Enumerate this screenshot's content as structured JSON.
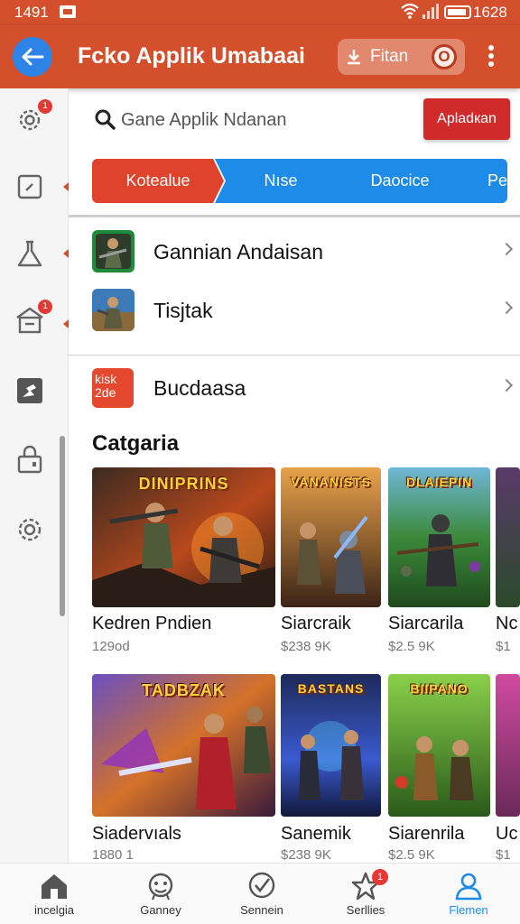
{
  "status_bar": {
    "time": "1491",
    "battery_text": "1628"
  },
  "app_bar": {
    "title": "Fcko Applik Umabaai",
    "filter_label": "Fitan",
    "record_glyph": "O"
  },
  "search": {
    "placeholder": "Gane Applik Ndanan",
    "upload_label": "Apladкan"
  },
  "tabs": [
    {
      "label": "Kotealue"
    },
    {
      "label": "Nıse"
    },
    {
      "label": "Daocice"
    },
    {
      "label": "Pe"
    }
  ],
  "side_rail": {
    "items": [
      {
        "icon": "gear-icon",
        "badge": "1"
      },
      {
        "icon": "note-icon",
        "badge": ""
      },
      {
        "icon": "flask-icon",
        "badge": ""
      },
      {
        "icon": "store-icon",
        "badge": "1"
      },
      {
        "icon": "puzzle-icon",
        "badge": ""
      },
      {
        "icon": "lock-icon",
        "badge": ""
      },
      {
        "icon": "settings-icon",
        "badge": ""
      }
    ]
  },
  "list": [
    {
      "label": "Gannian Andaisan",
      "thumb_text": ""
    },
    {
      "label": "Tisjtak",
      "thumb_text": ""
    },
    {
      "label": "Bucdaasa",
      "thumb_text": "kisk 2de"
    }
  ],
  "section_title": "Catgaria",
  "cards": [
    {
      "title": "Kedren Pndien",
      "meta": "129od",
      "banner": "DINIPRINS"
    },
    {
      "title": "Siarcraik",
      "meta": "$238 9K",
      "banner": "VANANISTS"
    },
    {
      "title": "Siarcarila",
      "meta": "$2.5 9K",
      "banner": "DLAIEPIN"
    },
    {
      "title": "Nc",
      "meta": "$1",
      "banner": ""
    },
    {
      "title": "Siadervıals",
      "meta": "1880 1",
      "banner": "TADBZAK"
    },
    {
      "title": "Sanemik",
      "meta": "$238 9K",
      "banner": "BASTANS"
    },
    {
      "title": "Siarenrila",
      "meta": "$2.5 9K",
      "banner": "BIIPANO"
    },
    {
      "title": "Uc",
      "meta": "$1",
      "banner": ""
    }
  ],
  "bottom_nav": [
    {
      "label": "incelgia",
      "icon": "home-icon",
      "badge": ""
    },
    {
      "label": "Ganney",
      "icon": "gamepad-icon",
      "badge": ""
    },
    {
      "label": "Sennein",
      "icon": "check-badge-icon",
      "badge": ""
    },
    {
      "label": "Serllies",
      "icon": "star-icon",
      "badge": "1"
    },
    {
      "label": "Flemen",
      "icon": "user-icon",
      "badge": ""
    }
  ],
  "colors": {
    "accent": "#d4502c",
    "tab_active": "#e0432b",
    "tab_blue": "#1e8be8",
    "upload": "#d12a2a",
    "active_nav": "#1e8be8"
  }
}
